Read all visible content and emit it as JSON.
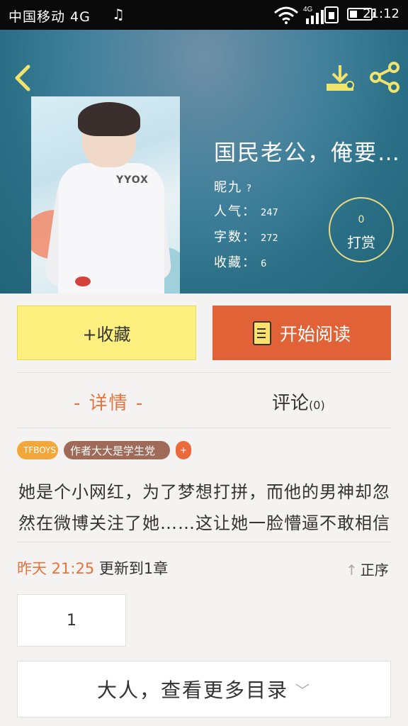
{
  "status": {
    "carrier": "中国移动 4G",
    "time": "21:12",
    "net_label": "4G",
    "battery_level": 0.35
  },
  "colors": {
    "accent": "#e8733e",
    "read_button": "#e26238",
    "fav_button": "#fdf07e",
    "tag_orange": "#f3a73b",
    "tag_brown": "#a06a58"
  },
  "header": {
    "back_icon": "back-chevron-icon",
    "download_icon": "download-icon",
    "share_icon": "share-icon"
  },
  "book": {
    "title": "国民老公，俺要…",
    "author_label": "昵九",
    "author_value": "?",
    "popularity_label": "人气：",
    "popularity_value": "247",
    "words_label": "字数：",
    "words_value": "272",
    "favorites_label": "收藏：",
    "favorites_value": "6",
    "reward_count": "0",
    "reward_label": "打赏"
  },
  "actions": {
    "favorite_label": "+收藏",
    "read_label": "开始阅读"
  },
  "tabs": {
    "detail_label": "- 详情 -",
    "comment_label": "评论",
    "comment_count": "(0)"
  },
  "tags": [
    "TFBOYS",
    "作者大大是学生党",
    "+"
  ],
  "description": "她是个小网红，为了梦想打拼，而他的男神却忽然在微博关注了她……这让她一脸懵逼不敢相信",
  "update": {
    "time": "昨天 21:25",
    "text": "更新到1章",
    "order_label": "正序"
  },
  "chapters": [
    "1"
  ],
  "more_label": "大人，查看更多目录"
}
